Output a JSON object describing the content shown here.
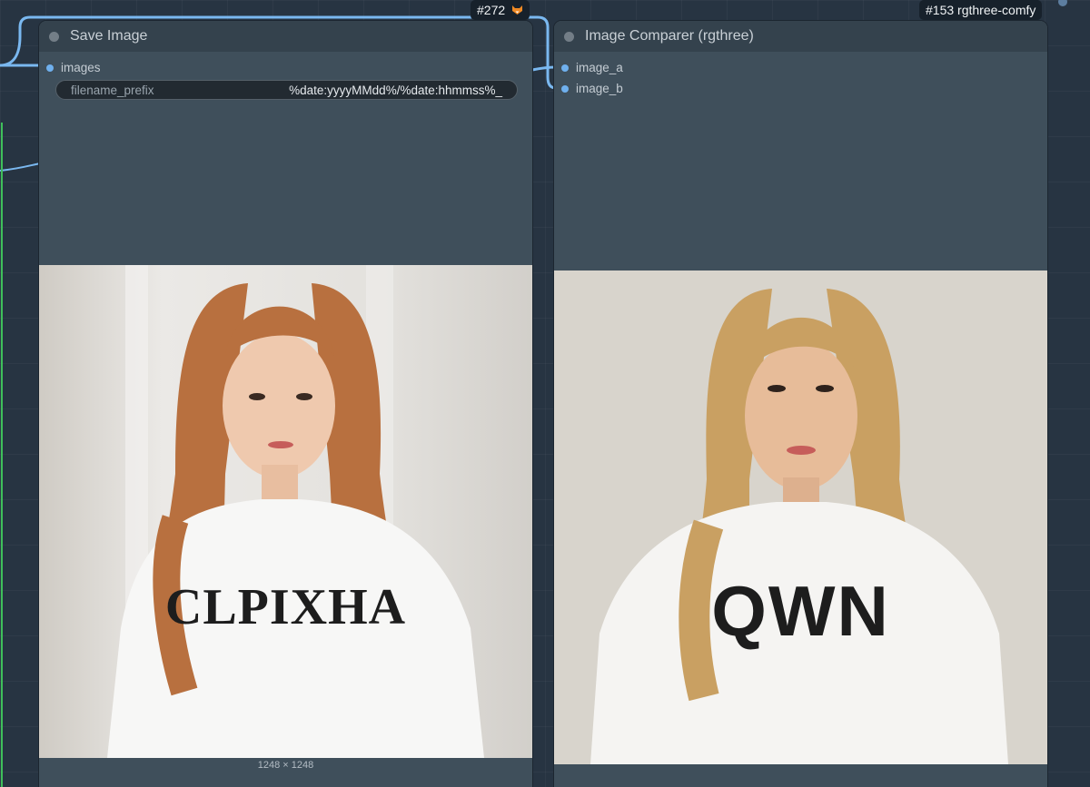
{
  "badges": {
    "save_node_id": "#272",
    "save_node_icon": "fox-icon",
    "comparer_node_id": "#153 rgthree-comfy"
  },
  "save_node": {
    "title": "Save Image",
    "input_slot": "images",
    "widget": {
      "label": "filename_prefix",
      "value": "%date:yyyyMMdd%/%date:hhmmss%_"
    },
    "preview_caption": "1248 × 1248",
    "preview": {
      "shirt_text": "CLPIXHA",
      "hair_color": "#b8703f",
      "background_color": "#e2e0db"
    }
  },
  "comparer_node": {
    "title": "Image Comparer (rgthree)",
    "inputs": [
      "image_a",
      "image_b"
    ],
    "preview": {
      "shirt_text": "QWN",
      "hair_color": "#c9a062",
      "background_color": "#d7d2ca"
    }
  },
  "colors": {
    "link": "#7ab8f0",
    "link_green": "#3fbf5a",
    "node_body": "#3f4f5b",
    "node_title": "#34424d",
    "slot_dot": "#6fb0ee"
  }
}
